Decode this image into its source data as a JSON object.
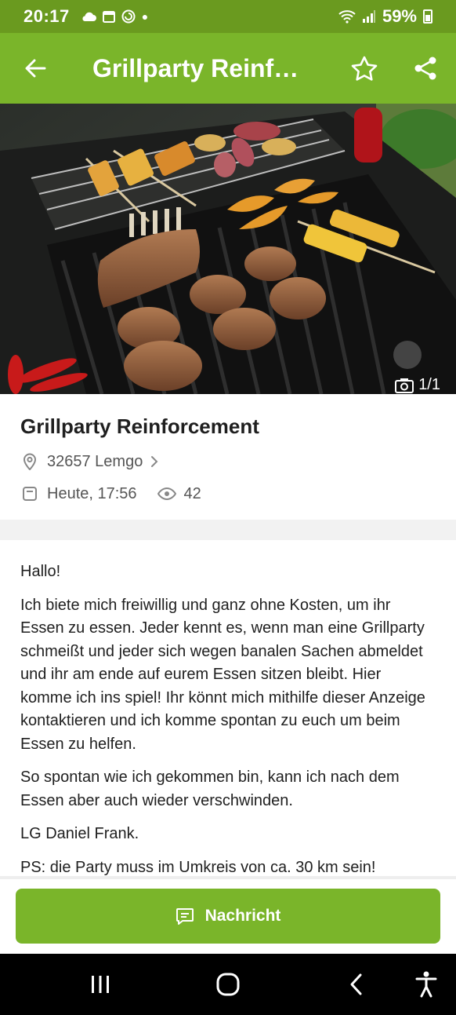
{
  "status_bar": {
    "time": "20:17",
    "battery": "59%"
  },
  "app_bar": {
    "title": "Grillparty Reinforc..."
  },
  "hero": {
    "photo_counter": "1/1"
  },
  "listing": {
    "title": "Grillparty Reinforcement",
    "location": "32657 Lemgo",
    "date": "Heute, 17:56",
    "views": "42"
  },
  "description": {
    "p1": "Hallo!",
    "p2": "Ich biete mich freiwillig und ganz ohne Kosten, um ihr Essen zu essen. Jeder kennt es, wenn man eine Grillparty schmeißt und jeder sich wegen banalen Sachen abmeldet und ihr am ende auf eurem Essen sitzen bleibt. Hier komme ich ins spiel! Ihr könnt mich mithilfe dieser Anzeige kontaktieren und ich komme spontan zu euch um beim Essen zu helfen.",
    "p3": "So spontan wie ich gekommen bin, kann ich nach dem Essen aber auch wieder verschwinden.",
    "p4": "LG Daniel Frank.",
    "p5": "PS: die Party muss im Umkreis von ca. 30 km sein!"
  },
  "actions": {
    "message_label": "Nachricht"
  },
  "colors": {
    "brand_green": "#7ab52a",
    "status_green": "#6a9a1f"
  },
  "icons": [
    "arrow-left-icon",
    "star-outline-icon",
    "share-icon",
    "location-pin-icon",
    "chevron-right-icon",
    "calendar-icon",
    "eye-icon",
    "message-icon",
    "camera-icon",
    "recents-icon",
    "home-icon",
    "nav-back-icon",
    "accessibility-icon"
  ]
}
